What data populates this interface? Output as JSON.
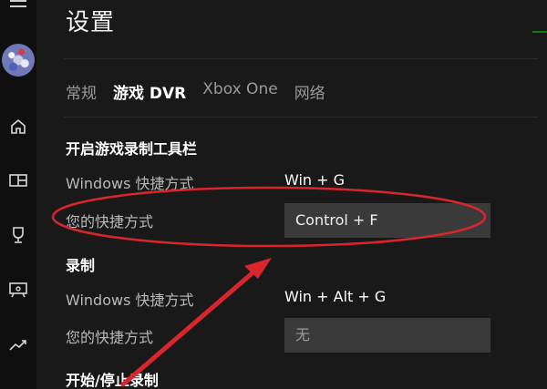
{
  "page": {
    "title": "设置"
  },
  "tabs": [
    {
      "label": "常规"
    },
    {
      "label": "游戏 DVR"
    },
    {
      "label": "Xbox One"
    },
    {
      "label": "网络"
    }
  ],
  "sections": {
    "toolbar": {
      "title": "开启游戏录制工具栏",
      "windows_label": "Windows 快捷方式",
      "windows_value": "Win + G",
      "custom_label": "您的快捷方式",
      "custom_value": "Control + F"
    },
    "record": {
      "title": "录制",
      "windows_label": "Windows 快捷方式",
      "windows_value": "Win + Alt + G",
      "custom_label": "您的快捷方式",
      "custom_value": "无"
    },
    "start_stop": {
      "title": "开始/停止录制"
    }
  },
  "sidebar": {
    "icons": [
      "menu-icon",
      "avatar",
      "home-icon",
      "store-icon",
      "trophy-icon",
      "game-dvr-icon",
      "trending-icon"
    ]
  },
  "colors": {
    "annotation": "#d9262c",
    "accent": "#107c10"
  }
}
